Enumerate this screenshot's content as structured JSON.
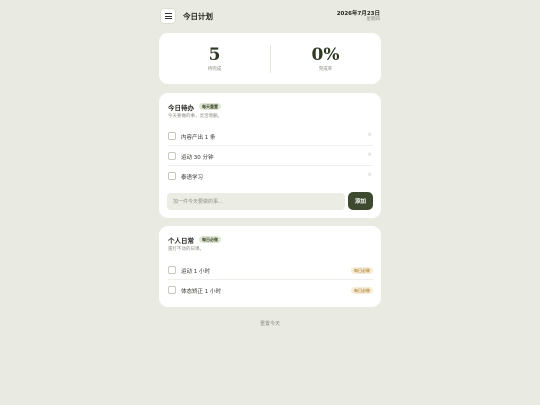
{
  "header": {
    "title": "今日计划",
    "date": "2026年7月23日",
    "weekday": "星期四"
  },
  "stats": [
    {
      "value": "5",
      "label": "待完成"
    },
    {
      "value": "0%",
      "label": "完成率"
    }
  ],
  "todo": {
    "title": "今日待办",
    "badge": "每天重置",
    "subtitle": "今天要做的事，灵活增删。",
    "items": [
      {
        "label": "内容产出 1 条",
        "delete": "×"
      },
      {
        "label": "运动 30 分钟",
        "delete": "×"
      },
      {
        "label": "泰语学习",
        "delete": "×"
      }
    ],
    "input_placeholder": "加一件今天要做的事...",
    "add_label": "添加"
  },
  "daily": {
    "title": "个人日常",
    "badge": "每日必做",
    "subtitle": "雷打不动的日课。",
    "items": [
      {
        "label": "运动 1 小时",
        "tag": "每日必做"
      },
      {
        "label": "体态矫正 1 小时",
        "tag": "每日必做"
      }
    ]
  },
  "footer": {
    "reset_label": "重置今天"
  },
  "colors": {
    "accent": "#3e4a2f",
    "background": "#e9eae1",
    "tag": "#f6ecd7"
  }
}
